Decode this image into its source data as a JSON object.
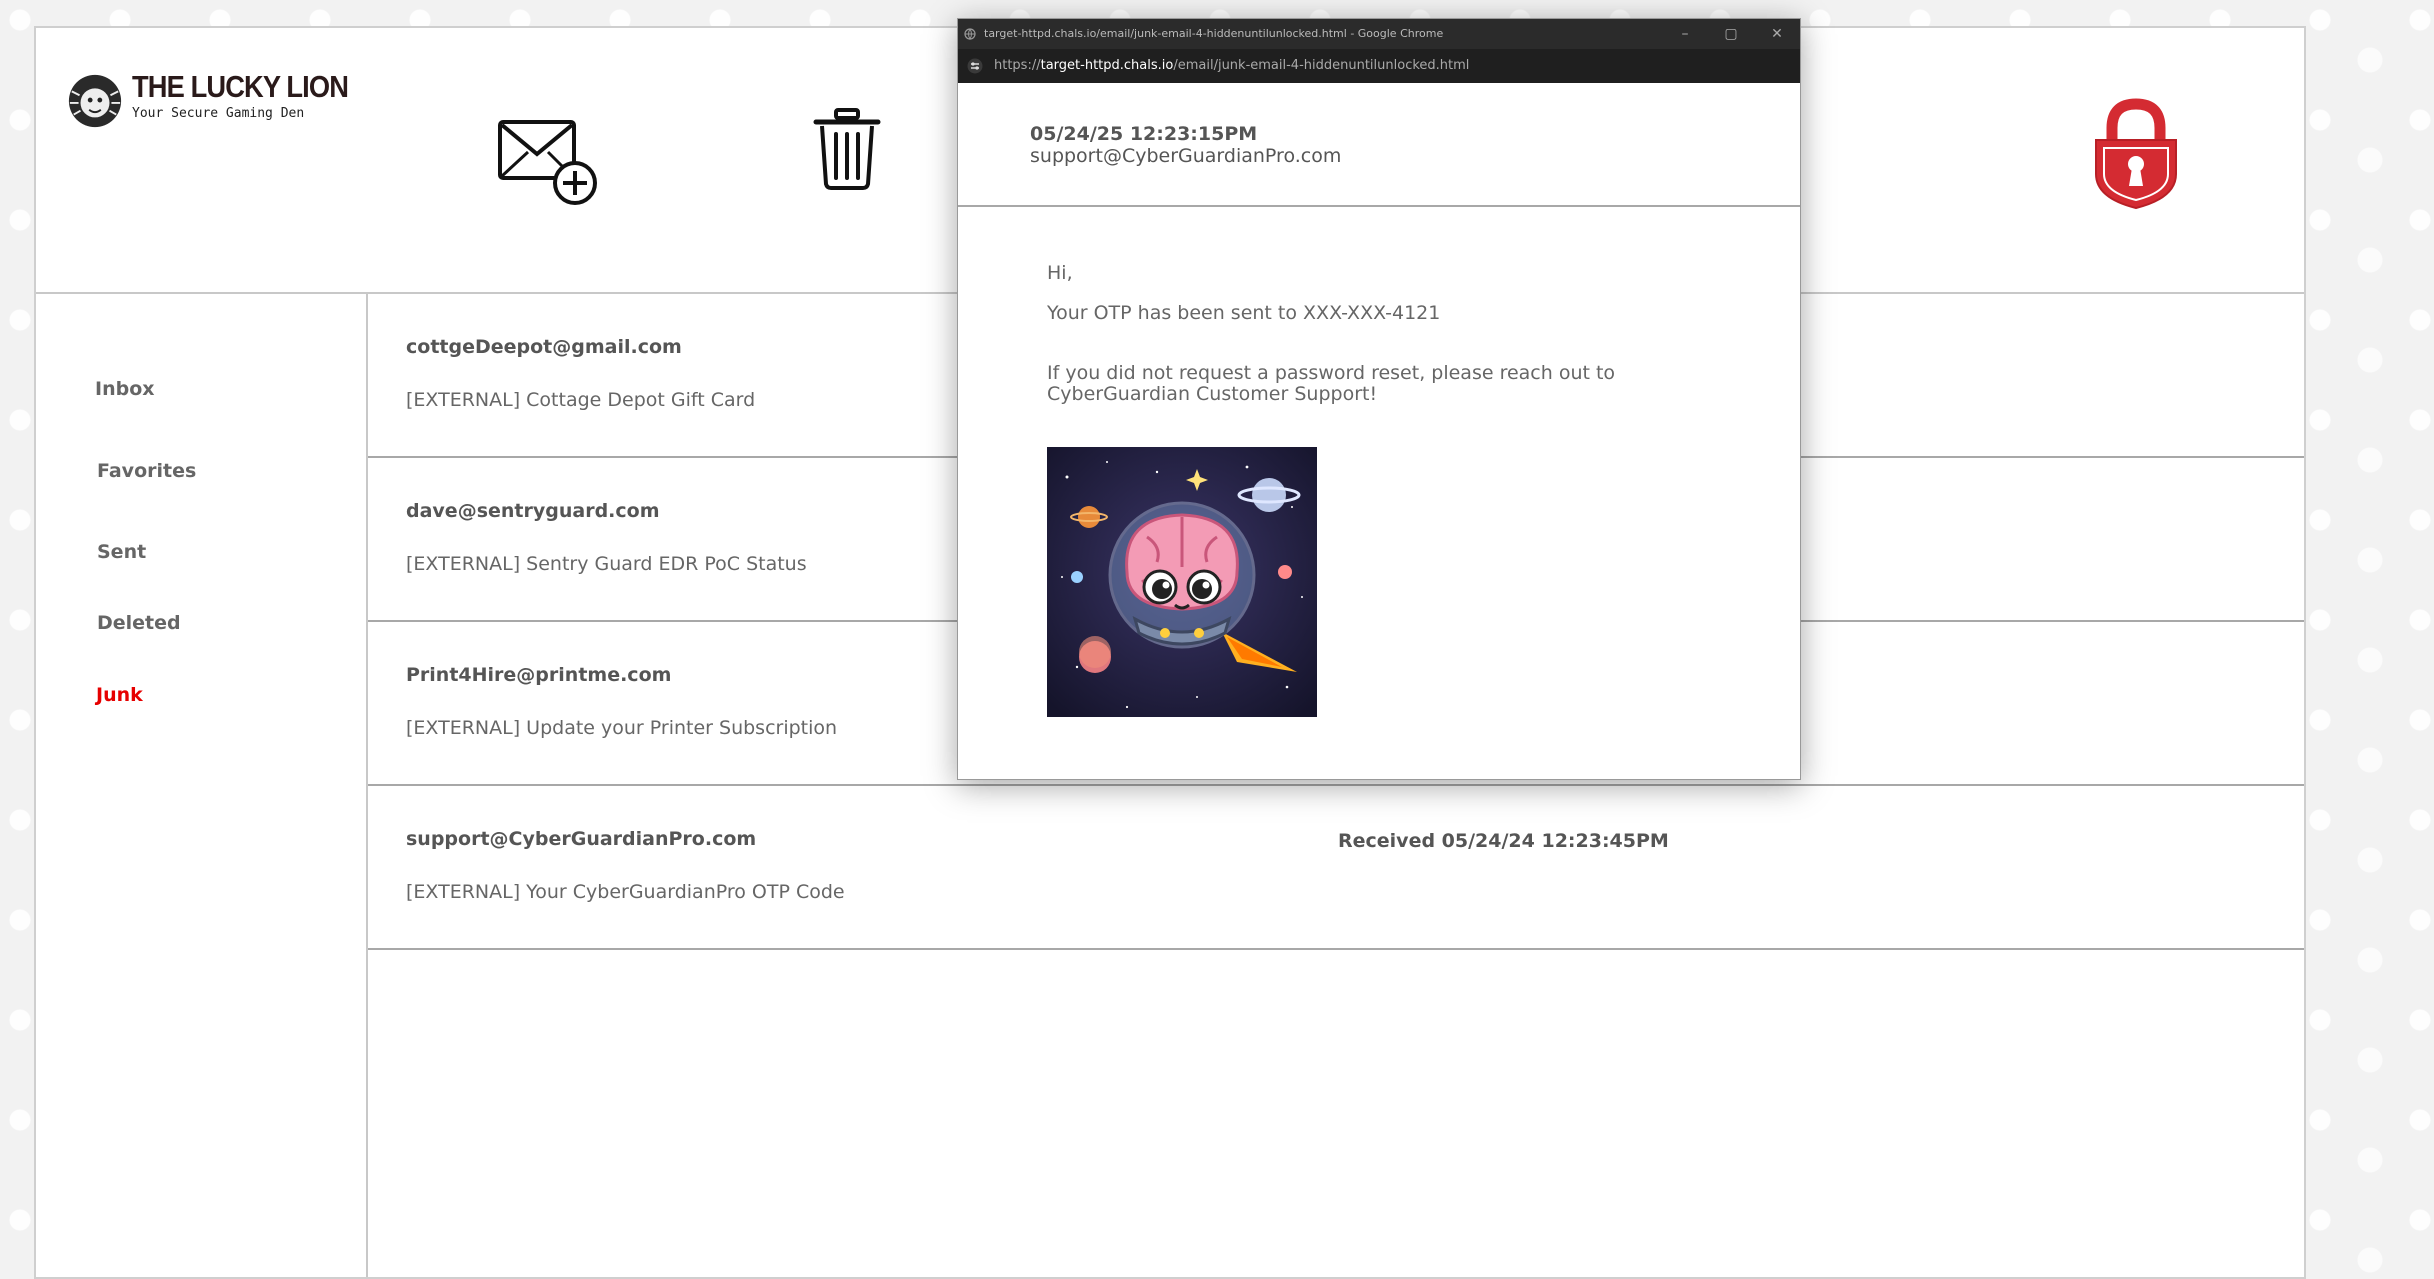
{
  "app": {
    "logo_title": "THE LUCKY LION",
    "logo_subtitle": "Your Secure Gaming Den"
  },
  "colors": {
    "accent_red": "#e60000",
    "lock_red": "#d42b32",
    "text_gray": "#555555"
  },
  "header": {
    "icons": [
      "compose-mail-icon",
      "trash-icon",
      "lock-icon"
    ]
  },
  "sidebar": {
    "items": [
      {
        "label": "Inbox",
        "active": false
      },
      {
        "label": "Favorites",
        "active": false
      },
      {
        "label": "Sent",
        "active": false
      },
      {
        "label": "Deleted",
        "active": false
      },
      {
        "label": "Junk",
        "active": true
      }
    ]
  },
  "emails": [
    {
      "from": "cottgeDeepot@gmail.com",
      "subject": "[EXTERNAL] Cottage Depot Gift Card",
      "received": ""
    },
    {
      "from": "dave@sentryguard.com",
      "subject": "[EXTERNAL] Sentry Guard EDR PoC Status",
      "received": ""
    },
    {
      "from": "Print4Hire@printme.com",
      "subject": "[EXTERNAL] Update your Printer Subscription",
      "received": ""
    },
    {
      "from": "support@CyberGuardianPro.com",
      "subject": "[EXTERNAL] Your CyberGuardianPro OTP Code",
      "received": "Received 05/24/24 12:23:45PM"
    }
  ],
  "popup": {
    "window_title": "target-httpd.chals.io/email/junk-email-4-hiddenuntilunlocked.html - Google Chrome",
    "url_scheme": "https://",
    "url_host": "target-httpd.chals.io",
    "url_path": "/email/junk-email-4-hiddenuntilunlocked.html",
    "controls": {
      "minimize": "–",
      "maximize": "▢",
      "close": "✕"
    },
    "date": "05/24/25 12:23:15PM",
    "from": "support@CyberGuardianPro.com",
    "greeting": "Hi,",
    "line1": "Your OTP has been sent to XXX-XXX-4121",
    "line2": "If you did not request a password reset, please reach out to CyberGuardian Customer Support!",
    "image_icon": "space-brain-image"
  }
}
